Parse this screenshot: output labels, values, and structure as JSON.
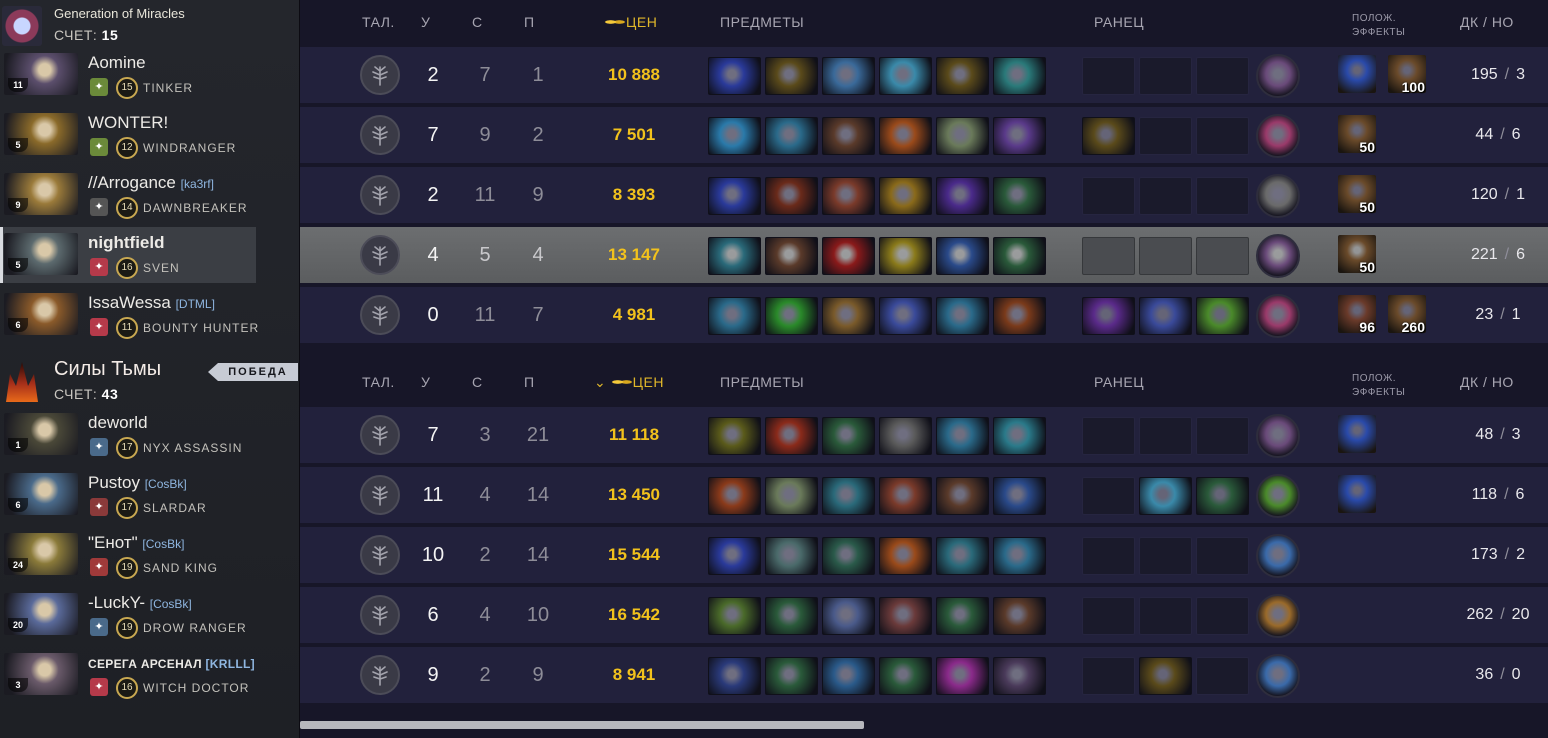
{
  "radiant": {
    "name": "Generation of Miracles",
    "score_label": "СЧЕТ:",
    "score": "15",
    "logo_color": "#8c3a5a",
    "players": [
      {
        "name": "Aomine",
        "tag": "",
        "level": "11",
        "hero_level": "15",
        "hero": "TINKER",
        "portrait": "#5b4e6c",
        "lane_color": "#6b8a3a"
      },
      {
        "name": "WONTER!",
        "tag": "",
        "level": "5",
        "hero_level": "12",
        "hero": "WINDRANGER",
        "portrait": "#8a6a2a",
        "lane_color": "#6b8a3a"
      },
      {
        "name": "//Arrogance",
        "tag": "[ka3rf]",
        "level": "9",
        "hero_level": "14",
        "hero": "DAWNBREAKER",
        "portrait": "#9a7a3a",
        "lane_color": "#555"
      },
      {
        "name": "nightfield",
        "tag": "",
        "level": "5",
        "hero_level": "16",
        "hero": "SVEN",
        "portrait": "#5c6a6e",
        "lane_color": "#b53a4a"
      },
      {
        "name": "IssaWessa",
        "tag": "[DTML]",
        "level": "6",
        "hero_level": "11",
        "hero": "BOUNTY HUNTER",
        "portrait": "#8a5a2a",
        "lane_color": "#b53a4a"
      }
    ]
  },
  "dire": {
    "name": "Силы Тьмы",
    "score_label": "СЧЕТ:",
    "score": "43",
    "victory": "ПОБЕДА",
    "players": [
      {
        "name": "deworld",
        "tag": "",
        "level": "1",
        "hero_level": "17",
        "hero": "NYX ASSASSIN",
        "portrait": "#4a4838",
        "lane_color": "#4a6a8a"
      },
      {
        "name": "Pustoy",
        "tag": "[CosBk]",
        "level": "6",
        "hero_level": "17",
        "hero": "SLARDAR",
        "portrait": "#4a6a8a",
        "lane_color": "#8a3a3a"
      },
      {
        "name": "\"Енот\"",
        "tag": "[CosBk]",
        "level": "24",
        "hero_level": "19",
        "hero": "SAND KING",
        "portrait": "#8a7a3a",
        "lane_color": "#a03a3a"
      },
      {
        "name": "-LuckY-",
        "tag": "[CosBk]",
        "level": "20",
        "hero_level": "19",
        "hero": "DROW RANGER",
        "portrait": "#5a6a9a",
        "lane_color": "#4a6a8a"
      },
      {
        "name": "СЕРЕГА АРСЕНАЛ",
        "tag": "[KRLLL]",
        "level": "3",
        "hero_level": "16",
        "hero": "WITCH DOCTOR",
        "portrait": "#6a5a6a",
        "lane_color": "#b53a4a"
      }
    ]
  },
  "headers": {
    "talents": "ТАЛ.",
    "kills": "У",
    "deaths": "С",
    "assists": "П",
    "networth": "ЦЕН",
    "items": "ПРЕДМЕТЫ",
    "backpack": "РАНЕЦ",
    "buffs_line1": "ПОЛОЖ.",
    "buffs_line2": "ЭФФЕКТЫ",
    "lasthits": "ДК",
    "denies": "НО"
  },
  "radiant_stats": [
    {
      "k": "2",
      "d": "7",
      "a": "1",
      "nw": "10 888",
      "lh": "195",
      "dn": "3",
      "items": [
        "#2a3a9a",
        "#5a4a1a",
        "#3a6a9a",
        "#3a8aaa",
        "#5a4a1a",
        "#2a7a7a"
      ],
      "backpack": [
        "",
        "",
        ""
      ],
      "neutral": "#6a4a7a",
      "buffs": [
        {
          "color": "#2a4aaa",
          "num": ""
        },
        {
          "color": "#6a4a2a",
          "num": "100"
        }
      ]
    },
    {
      "k": "7",
      "d": "9",
      "a": "2",
      "nw": "7 501",
      "lh": "44",
      "dn": "6",
      "items": [
        "#2a7aaa",
        "#2a6a8a",
        "#5a3a2a",
        "#9a4a1a",
        "#6a7a5a",
        "#5a3a8a"
      ],
      "backpack": [
        "#5a4a1a",
        "",
        ""
      ],
      "neutral": "#9a3a6a",
      "buffs": [
        {
          "color": "#6a4a2a",
          "num": "50"
        }
      ]
    },
    {
      "k": "2",
      "d": "11",
      "a": "9",
      "nw": "8 393",
      "lh": "120",
      "dn": "1",
      "items": [
        "#2a3a9a",
        "#6a2a1a",
        "#7a3a2a",
        "#8a6a1a",
        "#4a2a8a",
        "#2a5a3a"
      ],
      "backpack": [
        "",
        "",
        ""
      ],
      "neutral": "#6a6a6a",
      "buffs": [
        {
          "color": "#6a4a2a",
          "num": "50"
        }
      ]
    },
    {
      "k": "4",
      "d": "5",
      "a": "4",
      "nw": "13 147",
      "lh": "221",
      "dn": "6",
      "items": [
        "#2a6a7a",
        "#5a3a2a",
        "#8a1a1a",
        "#8a7a1a",
        "#2a4a8a",
        "#2a5a3a"
      ],
      "backpack": [
        "",
        "",
        ""
      ],
      "neutral": "#6a4a7a",
      "buffs": [
        {
          "color": "#6a4a2a",
          "num": "50"
        }
      ]
    },
    {
      "k": "0",
      "d": "11",
      "a": "7",
      "nw": "4 981",
      "lh": "23",
      "dn": "1",
      "items": [
        "#2a6a8a",
        "#2a8a2a",
        "#7a5a2a",
        "#3a4a9a",
        "#2a6a8a",
        "#7a3a1a"
      ],
      "backpack": [
        "#5a2a8a",
        "#3a4a9a",
        "#4a8a2a"
      ],
      "neutral": "#9a3a6a",
      "buffs": [
        {
          "color": "#6a3a2a",
          "num": "96"
        },
        {
          "color": "#6a4a2a",
          "num": "260"
        }
      ]
    }
  ],
  "dire_stats": [
    {
      "k": "7",
      "d": "3",
      "a": "21",
      "nw": "11 118",
      "lh": "48",
      "dn": "3",
      "items": [
        "#5a5a1a",
        "#8a2a1a",
        "#2a5a3a",
        "#5a5a5a",
        "#2a6a8a",
        "#2a7a8a"
      ],
      "backpack": [
        "",
        "",
        ""
      ],
      "neutral": "#6a4a7a",
      "buffs": [
        {
          "color": "#2a4aaa",
          "num": ""
        }
      ]
    },
    {
      "k": "11",
      "d": "4",
      "a": "14",
      "nw": "13 450",
      "lh": "118",
      "dn": "6",
      "items": [
        "#8a3a1a",
        "#6a7a5a",
        "#2a6a7a",
        "#7a3a2a",
        "#5a3a2a",
        "#2a4a8a"
      ],
      "backpack": [
        "",
        "#3a8aaa",
        "#2a5a3a"
      ],
      "neutral": "#4a8a2a",
      "buffs": [
        {
          "color": "#2a4aaa",
          "num": ""
        }
      ]
    },
    {
      "k": "10",
      "d": "2",
      "a": "14",
      "nw": "15 544",
      "lh": "173",
      "dn": "2",
      "items": [
        "#2a3a9a",
        "#4a6a6a",
        "#2a5a4a",
        "#9a4a1a",
        "#2a6a7a",
        "#2a6a8a"
      ],
      "backpack": [
        "",
        "",
        ""
      ],
      "neutral": "#3a6aaa",
      "buffs": []
    },
    {
      "k": "6",
      "d": "4",
      "a": "10",
      "nw": "16 542",
      "lh": "262",
      "dn": "20",
      "items": [
        "#4a6a2a",
        "#2a5a3a",
        "#4a5a8a",
        "#6a3a3a",
        "#2a5a3a",
        "#5a3a2a"
      ],
      "backpack": [
        "",
        "",
        ""
      ],
      "neutral": "#9a6a2a",
      "buffs": []
    },
    {
      "k": "9",
      "d": "2",
      "a": "9",
      "nw": "8 941",
      "lh": "36",
      "dn": "0",
      "items": [
        "#2a3a7a",
        "#2a5a3a",
        "#2a5a8a",
        "#2a5a3a",
        "#8a2a8a",
        "#4a3a5a"
      ],
      "backpack": [
        "",
        "#5a4a1a",
        ""
      ],
      "neutral": "#3a6aaa",
      "buffs": []
    }
  ]
}
